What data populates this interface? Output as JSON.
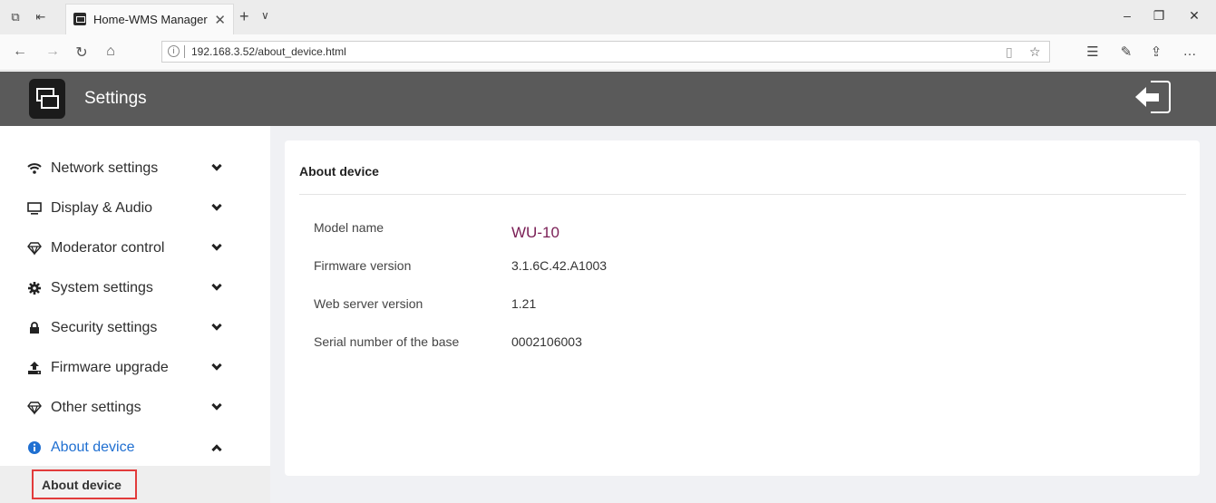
{
  "browser": {
    "tab_title": "Home-WMS Manager",
    "url": "192.168.3.52/about_device.html"
  },
  "header": {
    "title": "Settings"
  },
  "sidebar": {
    "items": [
      {
        "label": "Network settings",
        "icon": "wifi-icon"
      },
      {
        "label": "Display & Audio",
        "icon": "monitor-icon"
      },
      {
        "label": "Moderator control",
        "icon": "diamond-icon"
      },
      {
        "label": "System settings",
        "icon": "gear-icon"
      },
      {
        "label": "Security settings",
        "icon": "lock-icon"
      },
      {
        "label": "Firmware upgrade",
        "icon": "upload-icon"
      },
      {
        "label": "Other settings",
        "icon": "diamond-icon"
      },
      {
        "label": "About device",
        "icon": "info-icon",
        "active": true
      }
    ],
    "submenu": {
      "label": "About device"
    },
    "active_color": "#1f6fd1",
    "highlight_border_color": "#e23b3b"
  },
  "main": {
    "card_title": "About device",
    "rows": [
      {
        "label": "Model name",
        "value": "WU-10"
      },
      {
        "label": "Firmware version",
        "value": "3.1.6C.42.A1003"
      },
      {
        "label": "Web server version",
        "value": "1.21"
      },
      {
        "label": "Serial number of the base",
        "value": "0002106003"
      }
    ]
  },
  "colors": {
    "header_bg": "#5a5a5a",
    "model_value": "#7a1e55"
  }
}
